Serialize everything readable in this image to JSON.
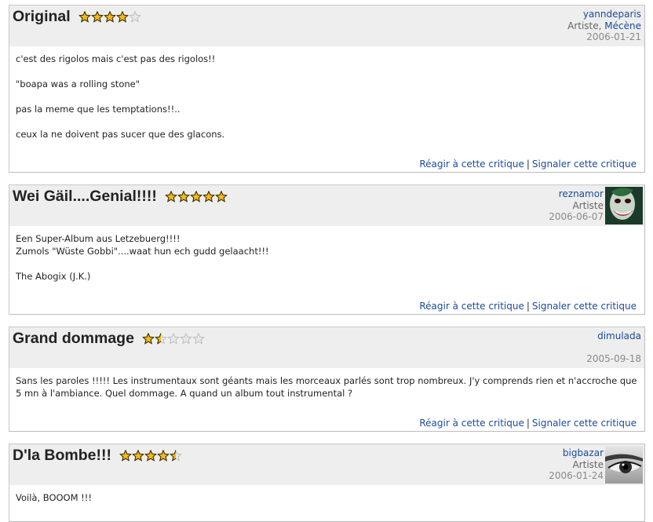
{
  "reviews": [
    {
      "title": "Original",
      "rating": 4,
      "user": "yanndeparis",
      "role": "Artiste",
      "role_link": "Mécène",
      "role_sep": ", ",
      "date": "2006-01-21",
      "body": [
        "c'est des rigolos mais c'est pas des rigolos!!",
        "",
        "\"boapa was a rolling stone\"",
        "",
        "pas la meme que les temptations!!..",
        "",
        "ceux la ne doivent pas sucer que des glacons."
      ]
    },
    {
      "title": "Wei Gäil....Genial!!!!",
      "rating": 5,
      "user": "reznamor",
      "role": "Artiste",
      "date": "2006-06-07",
      "avatar_icon": "joker-face-avatar",
      "body": [
        "Een Super-Album aus Letzebuerg!!!!",
        "Zumols \"Wüste Gobbi\"....waat hun ech gudd gelaacht!!!",
        "",
        "The Abogix (J.K.)"
      ]
    },
    {
      "title": "Grand dommage",
      "rating": 1.5,
      "user": "dimulada",
      "date": "2005-09-18",
      "body": [
        "Sans les paroles !!!!! Les instrumentaux sont géants mais les morceaux parlés sont trop nombreux. J'y comprends rien et n'accroche que 5 mn à l'ambiance. Quel dommage. A quand un album tout instrumental ?"
      ]
    },
    {
      "title": "D'la Bombe!!!",
      "rating": 4.5,
      "user": "bigbazar",
      "role": "Artiste",
      "date": "2006-01-24",
      "avatar_icon": "eye-closeup-avatar",
      "body": [
        "Voilà, BOOOM !!!"
      ]
    }
  ],
  "actions": {
    "react": "Réagir à cette critique",
    "separator": "|",
    "report": "Signaler cette critique"
  },
  "colors": {
    "star_fill": "#f2b91c",
    "star_empty": "#e8e8e8",
    "link": "#1a4b9b",
    "header_bg": "#eeeeee"
  }
}
